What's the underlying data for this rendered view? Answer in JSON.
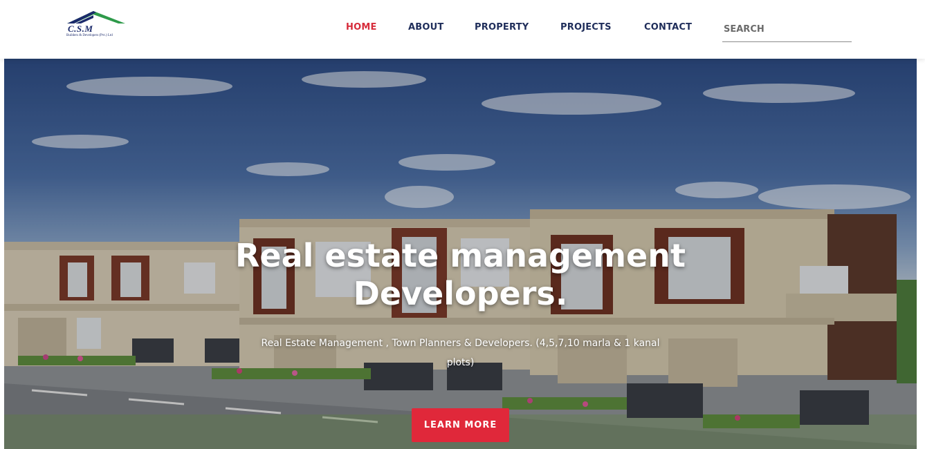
{
  "brand": {
    "logo_text": "C.S.M",
    "logo_subtext": "Builders & Developers (Pvt.) Ltd",
    "colors": {
      "roof_blue": "#1b2a6b",
      "roof_green": "#2e9a4a"
    }
  },
  "nav": {
    "items": [
      {
        "label": "HOME",
        "active": true
      },
      {
        "label": "ABOUT",
        "active": false
      },
      {
        "label": "PROPERTY",
        "active": false
      },
      {
        "label": "PROJECTS",
        "active": false
      },
      {
        "label": "CONTACT",
        "active": false
      }
    ],
    "search_placeholder": "SEARCH"
  },
  "hero": {
    "title_line1": "Real estate management",
    "title_line2": "Developers.",
    "subtitle": "Real Estate Management , Town Planners & Developers. (4,5,7,10 marla & 1 kanal plots)",
    "button_label": "LEARN MORE"
  },
  "colors": {
    "accent": "#e0283a",
    "nav_text": "#1f2d5a",
    "nav_active": "#d62b3a"
  }
}
